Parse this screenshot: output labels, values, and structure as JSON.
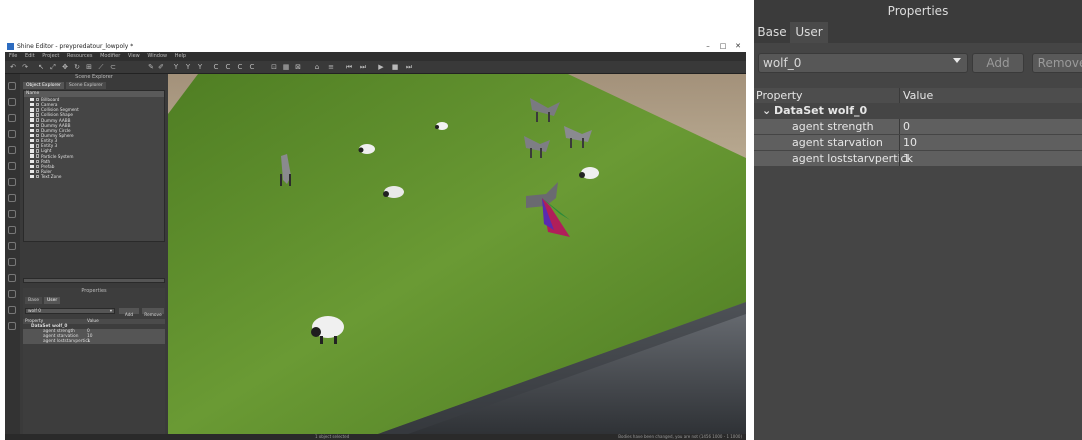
{
  "editor": {
    "window_title": "Shine Editor - preypredatour_lowpoly *",
    "menu": [
      "File",
      "Edit",
      "Project",
      "Resources",
      "Modifier",
      "View",
      "Window",
      "Help"
    ],
    "scene_explorer": {
      "panel_title": "Scene Explorer",
      "tabs": [
        "Object Explorer",
        "Scene Explorer"
      ],
      "column_header": "Name",
      "items": [
        "Billboard",
        "Camera",
        "Collision Segment",
        "Collision Shape",
        "Dummy AABB",
        "Dummy AABB",
        "Dummy Circle",
        "Dummy Sphere",
        "Entity 3",
        "Entity 3",
        "Light",
        "Particle System",
        "Path",
        "Prefab",
        "Ruler",
        "Text Zone"
      ]
    },
    "properties_mini": {
      "title": "Properties",
      "tabs": [
        "Base",
        "User"
      ],
      "selected": "wolf 0",
      "add": "Add",
      "remove": "Remove",
      "col_property": "Property",
      "col_value": "Value",
      "dataset": "DataSet wolf_0",
      "rows": [
        {
          "name": "agent strength",
          "value": "0"
        },
        {
          "name": "agent starvation",
          "value": "10"
        },
        {
          "name": "agent loststarvpertick",
          "value": "1"
        }
      ]
    },
    "status_left": "1 object selected",
    "status_right": "Bodies have been changed, you are not (1456 1000 - 1 1000)"
  },
  "properties": {
    "title": "Properties",
    "tabs": [
      "Base",
      "User"
    ],
    "active_tab": "User",
    "dataset_select": "wolf_0",
    "add_label": "Add",
    "remove_label": "Remove",
    "col_property": "Property",
    "col_value": "Value",
    "dataset_label": "DataSet wolf_0",
    "rows": [
      {
        "name": "agent strength",
        "value": "0"
      },
      {
        "name": "agent starvation",
        "value": "10"
      },
      {
        "name": "agent loststarvpertick",
        "value": "1"
      }
    ]
  },
  "colors": {
    "panel_bg": "#454545",
    "row_selected": "#5f5f5f",
    "grass": "#5a8a2e",
    "sky": "#b8a58a"
  },
  "icons": [
    "chevron-down-icon",
    "caret-down-icon",
    "checkbox-icon",
    "play-icon",
    "stop-icon",
    "close-icon",
    "minimize-icon",
    "maximize-icon"
  ]
}
